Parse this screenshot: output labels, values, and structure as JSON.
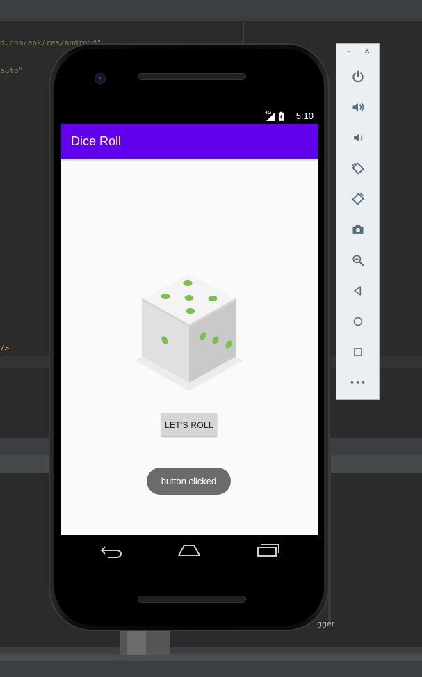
{
  "ide": {
    "code_lines": [
      {
        "text": "d.com/apk/res/android\"",
        "kind": "s"
      },
      {
        "text": "auto\"",
        "kind": "s"
      },
      {
        "text": "/>",
        "kind": "t"
      }
    ],
    "debugger_label": "gger"
  },
  "emulator_toolbar": {
    "minimize_label": "–",
    "close_label": "✕",
    "buttons": [
      {
        "name": "power-icon"
      },
      {
        "name": "volume-up-icon"
      },
      {
        "name": "volume-down-icon"
      },
      {
        "name": "rotate-left-icon"
      },
      {
        "name": "rotate-right-icon"
      },
      {
        "name": "camera-icon"
      },
      {
        "name": "zoom-icon"
      },
      {
        "name": "back-triangle-icon"
      },
      {
        "name": "home-circle-icon"
      },
      {
        "name": "overview-square-icon"
      },
      {
        "name": "more-icon"
      }
    ],
    "more_label": "•••"
  },
  "status_bar": {
    "network": "4G",
    "time": "5:10"
  },
  "app": {
    "title": "Dice Roll",
    "accent_color": "#6200ee",
    "dice_pip_color": "#7ac04f",
    "roll_button_label": "LET'S ROLL"
  },
  "toast": {
    "message": "button clicked"
  }
}
